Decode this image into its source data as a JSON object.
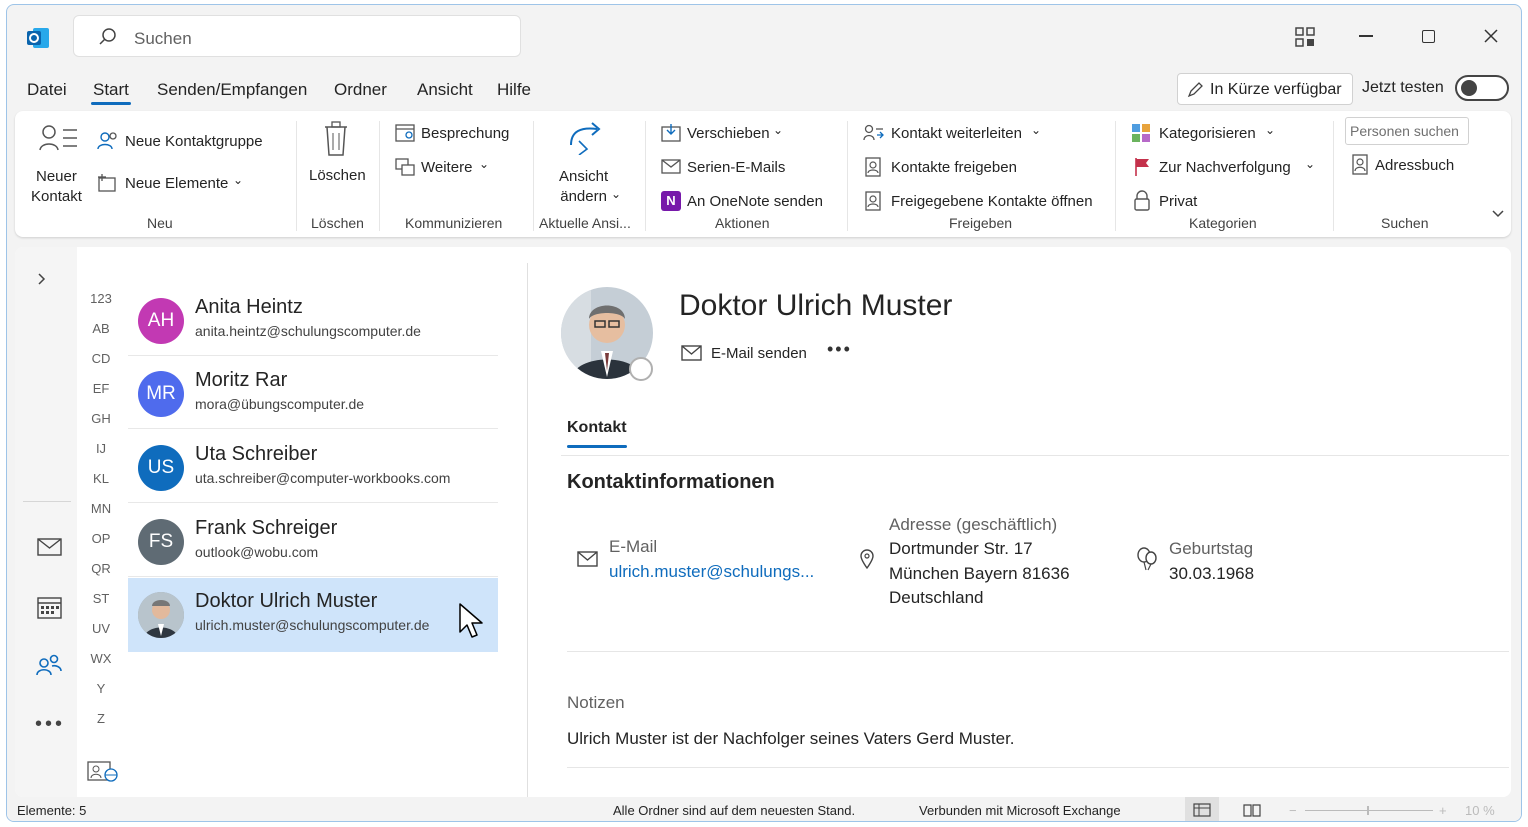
{
  "titlebar": {
    "search_placeholder": "Suchen"
  },
  "menu": {
    "items": [
      "Datei",
      "Start",
      "Senden/Empfangen",
      "Ordner",
      "Ansicht",
      "Hilfe"
    ],
    "coming_soon": "In Kürze verfügbar",
    "try_now": "Jetzt testen"
  },
  "ribbon": {
    "neuer_kontakt": "Neuer\nKontakt",
    "neue_kontaktgruppe": "Neue Kontaktgruppe",
    "neue_elemente": "Neue Elemente",
    "group_neu": "Neu",
    "loeschen": "Löschen",
    "group_loeschen": "Löschen",
    "besprechung": "Besprechung",
    "weitere": "Weitere",
    "group_kommunizieren": "Kommunizieren",
    "ansicht_aendern": "Ansicht\nändern",
    "group_aktuelle": "Aktuelle Ansi...",
    "verschieben": "Verschieben",
    "serien": "Serien-E-Mails",
    "onenote": "An OneNote senden",
    "group_aktionen": "Aktionen",
    "kontakt_weiterleiten": "Kontakt weiterleiten",
    "kontakte_freigeben": "Kontakte freigeben",
    "freigegebene_oeffnen": "Freigegebene Kontakte öffnen",
    "group_freigeben": "Freigeben",
    "kategorisieren": "Kategorisieren",
    "nachverfolgung": "Zur Nachverfolgung",
    "privat": "Privat",
    "group_kategorien": "Kategorien",
    "personen_suchen": "Personen suchen",
    "adressbuch": "Adressbuch",
    "group_suchen": "Suchen"
  },
  "alphabet": [
    "123",
    "AB",
    "CD",
    "EF",
    "GH",
    "IJ",
    "KL",
    "MN",
    "OP",
    "QR",
    "ST",
    "UV",
    "WX",
    "Y",
    "Z"
  ],
  "contacts": [
    {
      "initials": "AH",
      "name": "Anita Heintz",
      "email": "anita.heintz@schulungscomputer.de",
      "color": "#c239b3"
    },
    {
      "initials": "MR",
      "name": "Moritz Rar",
      "email": "mora@übungscomputer.de",
      "color": "#4f6bed"
    },
    {
      "initials": "US",
      "name": "Uta Schreiber",
      "email": "uta.schreiber@computer-workbooks.com",
      "color": "#0f6cbd"
    },
    {
      "initials": "FS",
      "name": "Frank Schreiger",
      "email": "outlook@wobu.com",
      "color": "#5f6b74"
    },
    {
      "initials": "",
      "name": "Doktor Ulrich Muster",
      "email": "ulrich.muster@schulungscomputer.de",
      "color": "#cfe4fa"
    }
  ],
  "detail": {
    "name": "Doktor Ulrich Muster",
    "send_mail": "E-Mail senden",
    "tab": "Kontakt",
    "section": "Kontaktinformationen",
    "email_label": "E-Mail",
    "email_value": "ulrich.muster@schulungs...",
    "address_label": "Adresse (geschäftlich)",
    "address_line1": "Dortmunder Str. 17",
    "address_line2": "München Bayern 81636",
    "address_line3": "Deutschland",
    "birthday_label": "Geburtstag",
    "birthday_value": "30.03.1968",
    "notes_label": "Notizen",
    "notes_value": "Ulrich Muster ist der Nachfolger seines Vaters Gerd Muster."
  },
  "status": {
    "items": "Elemente: 5",
    "sync": "Alle Ordner sind auf dem neuesten Stand.",
    "connected": "Verbunden mit Microsoft Exchange",
    "zoom": "10 %"
  },
  "colors": {
    "accent": "#0f6cbd",
    "selected": "#cfe4fa",
    "link": "#0f6cbd"
  }
}
